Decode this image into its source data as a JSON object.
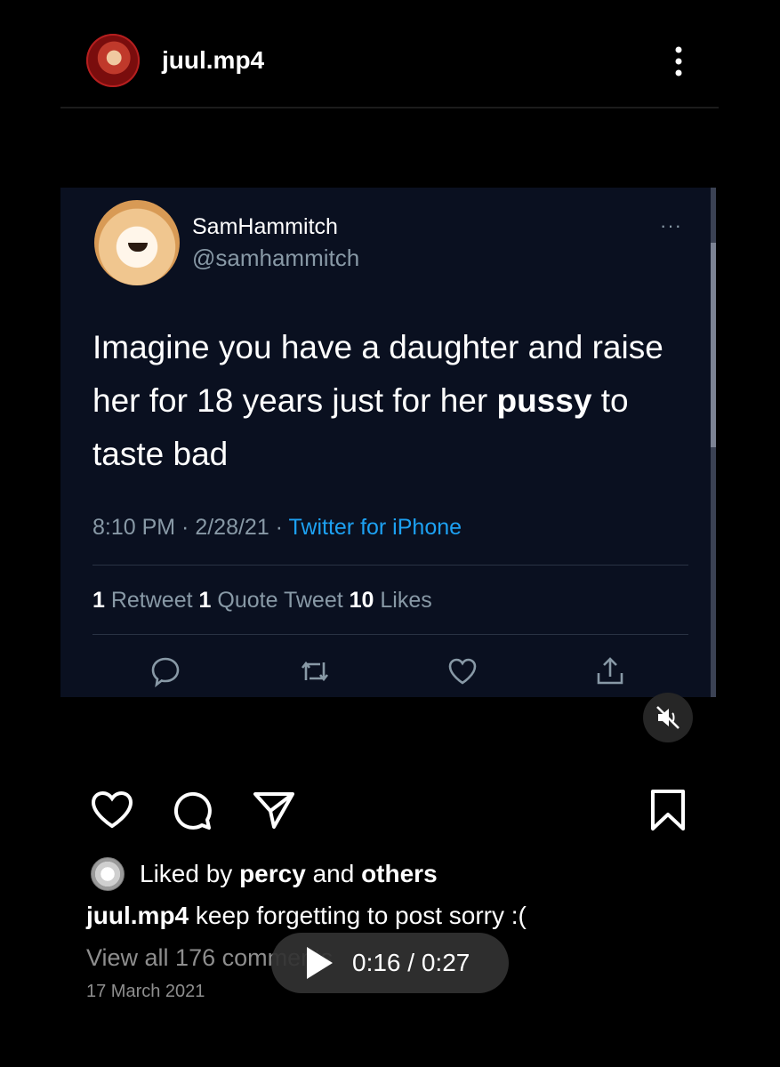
{
  "post": {
    "username": "juul.mp4",
    "liked_by_prefix": "Liked by ",
    "liked_by_user": "percy",
    "liked_by_and": " and ",
    "liked_by_others": "others",
    "caption_user": "juul.mp4",
    "caption_text": " keep forgetting to post sorry :(",
    "comments_link": "View all 176 comments",
    "date": "17 March 2021"
  },
  "tweet": {
    "display_name": "SamHammitch",
    "handle": "@samhammitch",
    "text_part1": "Imagine you have a daughter and raise her for 18 years just for her ",
    "text_bold": "pussy",
    "text_part2": " to taste bad",
    "time_date": "8:10 PM · 2/28/21 · ",
    "source": "Twitter for iPhone",
    "retweets_count": "1",
    "retweets_label": " Retweet ",
    "quotes_count": "1",
    "quotes_label": " Quote Tweet ",
    "likes_count": "10",
    "likes_label": " Likes",
    "more_dots": "···"
  },
  "video": {
    "current_time": "0:16",
    "separator": " / ",
    "duration": "0:27",
    "muted": true
  },
  "icons": {
    "header_more": "more-vertical-icon",
    "like": "heart-icon",
    "comment": "comment-icon",
    "share": "send-icon",
    "save": "bookmark-icon",
    "mute": "speaker-muted-icon",
    "play": "play-icon"
  }
}
